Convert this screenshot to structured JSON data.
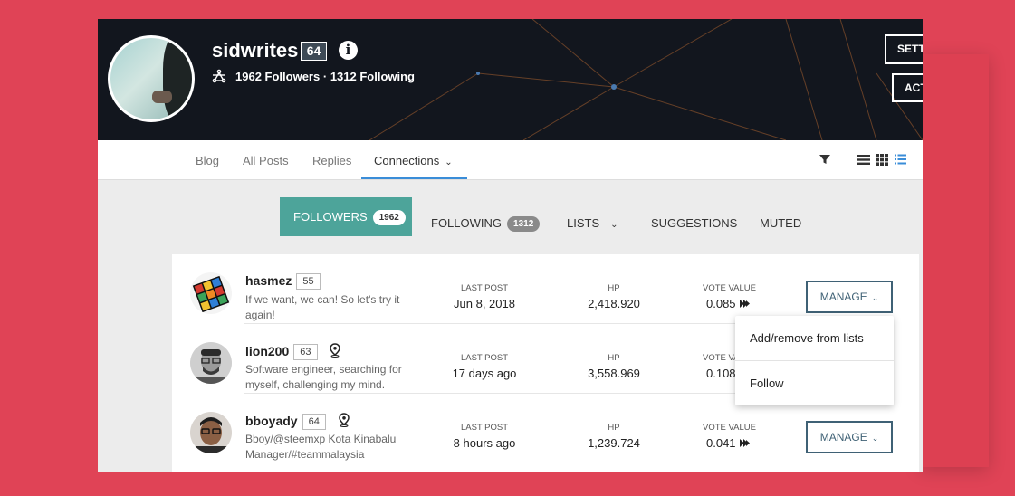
{
  "profile": {
    "username": "sidwrites",
    "reputation": "64",
    "followers_text": "1962 Followers",
    "separator": "·",
    "following_text": "1312 Following",
    "settings_label": "SETT",
    "activity_label": "ACT"
  },
  "tabs": [
    {
      "label": "Blog"
    },
    {
      "label": "All Posts"
    },
    {
      "label": "Replies"
    },
    {
      "label": "Connections"
    }
  ],
  "subtabs": {
    "followers": {
      "label": "FOLLOWERS",
      "count": "1962"
    },
    "following": {
      "label": "FOLLOWING",
      "count": "1312"
    },
    "lists": {
      "label": "LISTS"
    },
    "suggestions": {
      "label": "SUGGESTIONS"
    },
    "muted": {
      "label": "MUTED"
    }
  },
  "columns": {
    "last_post": "LAST POST",
    "hp": "HP",
    "vote_value": "VOTE VALUE",
    "vote_value_cut": "VOTE VAL"
  },
  "rows": [
    {
      "name": "hasmez",
      "rep": "55",
      "bio": "If we want, we can! So let's try it again!",
      "last_post": "Jun 8, 2018",
      "hp": "2,418.920",
      "vote_value": "0.085",
      "manage": "MANAGE"
    },
    {
      "name": "lion200",
      "rep": "63",
      "bio": "Software engineer, searching for myself, challenging my mind.",
      "last_post": "17 days ago",
      "hp": "3,558.969",
      "vote_value": "0.108",
      "manage": "MANAGE"
    },
    {
      "name": "bboyady",
      "rep": "64",
      "bio": "Bboy/@steemxp Kota Kinabalu Manager/#teammalaysia",
      "last_post": "8 hours ago",
      "hp": "1,239.724",
      "vote_value": "0.041",
      "manage": "MANAGE"
    }
  ],
  "dropdown": {
    "item1": "Add/remove from lists",
    "item2": "Follow"
  },
  "colors": {
    "page_bg": "#e04356",
    "accent_teal": "#4da49a",
    "manage_border": "#3f6175",
    "tab_underline": "#3a8dd8"
  }
}
